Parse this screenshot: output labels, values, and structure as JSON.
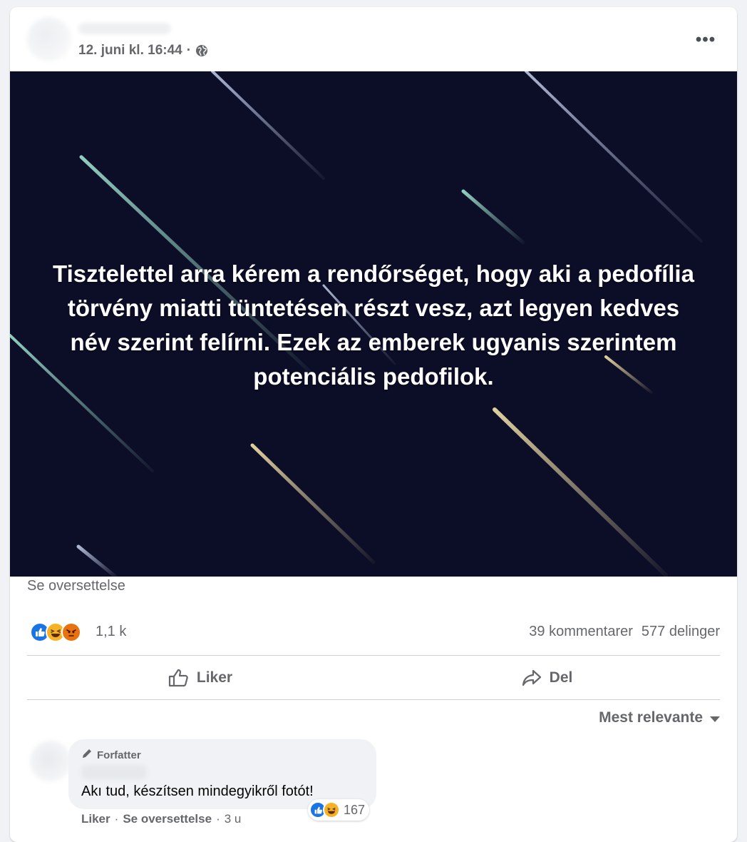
{
  "post": {
    "timestamp": "12. juni kl. 16:44",
    "separator": "·",
    "privacy_icon": "globe-icon",
    "more_label": "•••",
    "image_text": "Tisztelettel arra kérem a rendőrséget, hogy aki a pedofília törvény miatti tüntetésen részt vesz, azt legyen kedves név szerint felírni. Ezek az emberek ugyanis szerintem potenciális pedofilok.",
    "image_background": "#0c0d26",
    "translate_label": "Se oversettelse"
  },
  "summary": {
    "reaction_icons": [
      "like-icon",
      "haha-icon",
      "angry-icon"
    ],
    "reaction_count": "1,1 k",
    "comments_label": "39 kommentarer",
    "shares_label": "577 delinger"
  },
  "actions": {
    "like_label": "Liker",
    "share_label": "Del"
  },
  "sort": {
    "label": "Mest relevante"
  },
  "comment": {
    "badge_label": "Forfatter",
    "text": "Akı tud, készítsen mindegyikről fotót!",
    "reaction_icons": [
      "like-icon",
      "haha-icon"
    ],
    "reaction_count": "167",
    "like_label": "Liker",
    "dot1": "·",
    "translate_label": "Se oversettelse",
    "dot2": "·",
    "age": "3 u"
  },
  "colors": {
    "like_blue": "#1b74e4",
    "haha_yellow": "#f7b125",
    "angry_orange": "#e9710f",
    "secondary_text": "#65676b"
  }
}
